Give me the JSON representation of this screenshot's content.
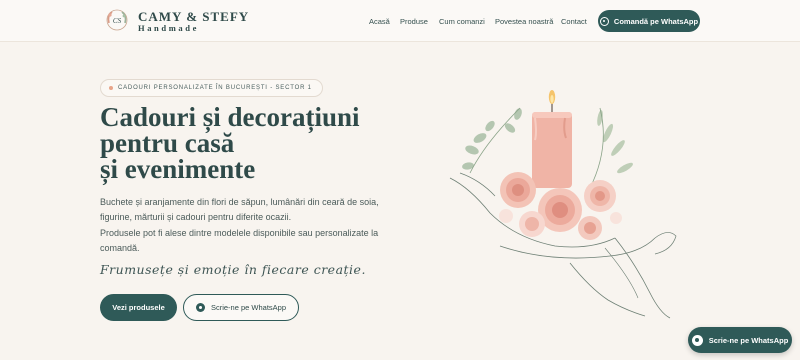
{
  "brand": {
    "name": "CAMY & STEFY",
    "subtitle": "Handmade"
  },
  "nav": {
    "items": [
      "Acasă",
      "Produse",
      "Cum comanzi",
      "Povestea noastră",
      "Contact"
    ],
    "cta": "Comandă pe WhatsApp"
  },
  "hero": {
    "badge": "CADOURI PERSONALIZATE ÎN BUCUREȘTI - SECTOR 1",
    "title_lines": [
      "Cadouri și decorațiuni",
      "pentru casă",
      "și evenimente"
    ],
    "description_1": "Buchete și aranjamente din flori de săpun, lumânări din ceară de soia, figurine, mărturii și cadouri pentru diferite ocazii.",
    "description_2": "Produsele pot fi alese dintre modelele disponibile sau personalizate la comandă.",
    "tagline": "Frumusețe și emoție în fiecare creație.",
    "primary_button": "Vezi produsele",
    "secondary_button": "Scrie-ne pe WhatsApp"
  },
  "floating_button": "Scrie-ne pe WhatsApp",
  "colors": {
    "background": "#f8f4ef",
    "accent": "#2f5a58",
    "text": "#2f4a49"
  }
}
